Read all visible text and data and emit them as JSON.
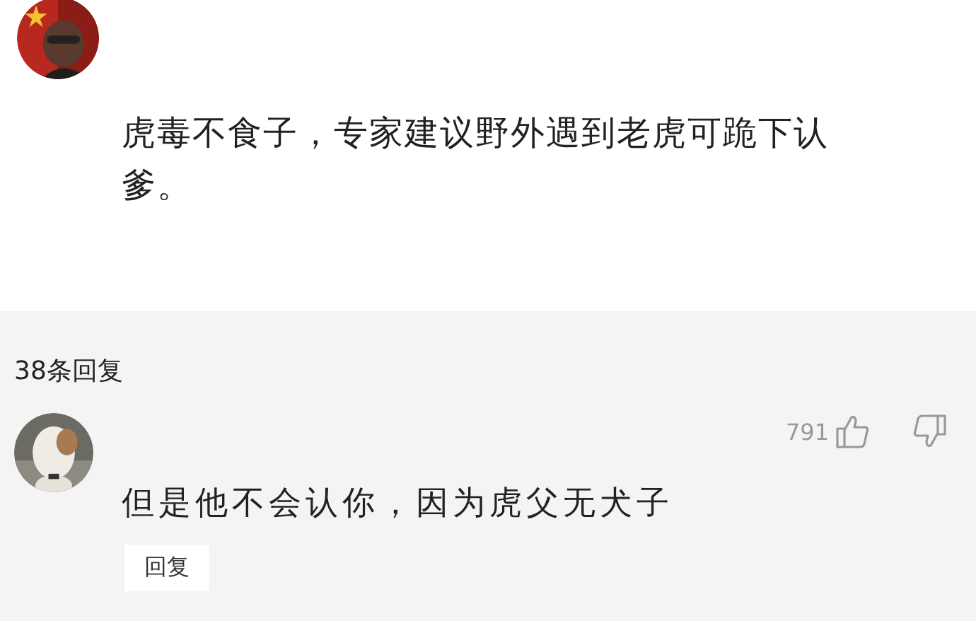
{
  "post": {
    "text": "虎毒不食子，专家建议野外遇到老虎可跪下认爹。"
  },
  "replies_header": {
    "count": "38条回复"
  },
  "replies": [
    {
      "likes": "791",
      "text": "但是他不会认你，因为虎父无犬子",
      "reply_button": "回复"
    }
  ]
}
